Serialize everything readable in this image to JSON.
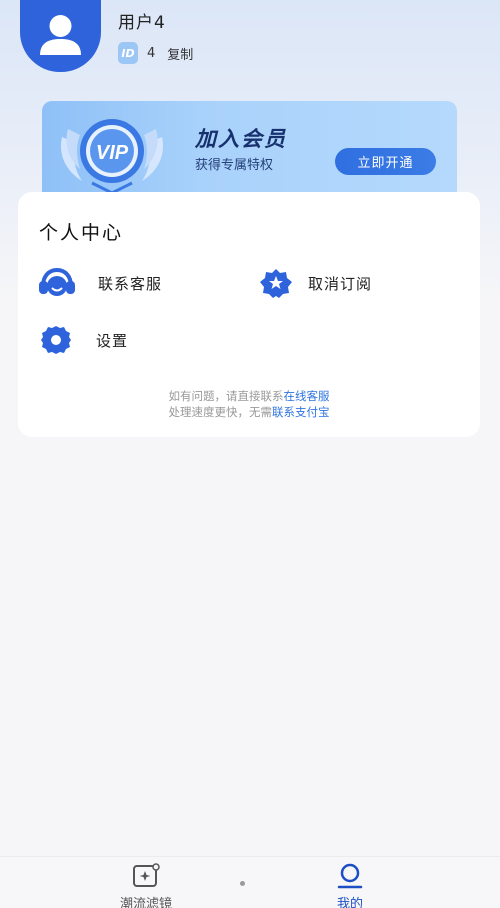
{
  "user": {
    "name": "用户4",
    "id_badge": "ID",
    "id_value": "4",
    "copy_label": "复制"
  },
  "vip": {
    "title": "加入会员",
    "subtitle": "获得专属特权",
    "button_label": "立即开通",
    "emblem_text": "VIP"
  },
  "personal_center": {
    "title": "个人中心",
    "items": [
      {
        "label": "联系客服",
        "icon": "headset-icon"
      },
      {
        "label": "取消订阅",
        "icon": "star-badge-icon"
      },
      {
        "label": "设置",
        "icon": "gear-icon"
      }
    ],
    "notice_line1": "如有问题，请直接联系",
    "notice_link1": "在线客服",
    "notice_line2": "处理速度更快，无需",
    "notice_link2": "联系支付宝"
  },
  "tabbar": {
    "tabs": [
      {
        "label": "潮流滤镜",
        "icon": "photo-sparkle-icon"
      },
      {
        "label": "我的",
        "icon": "user-icon"
      }
    ]
  },
  "colors": {
    "accent": "#2f63dc",
    "link": "#2f74e0",
    "vip_dark": "#17316e"
  }
}
